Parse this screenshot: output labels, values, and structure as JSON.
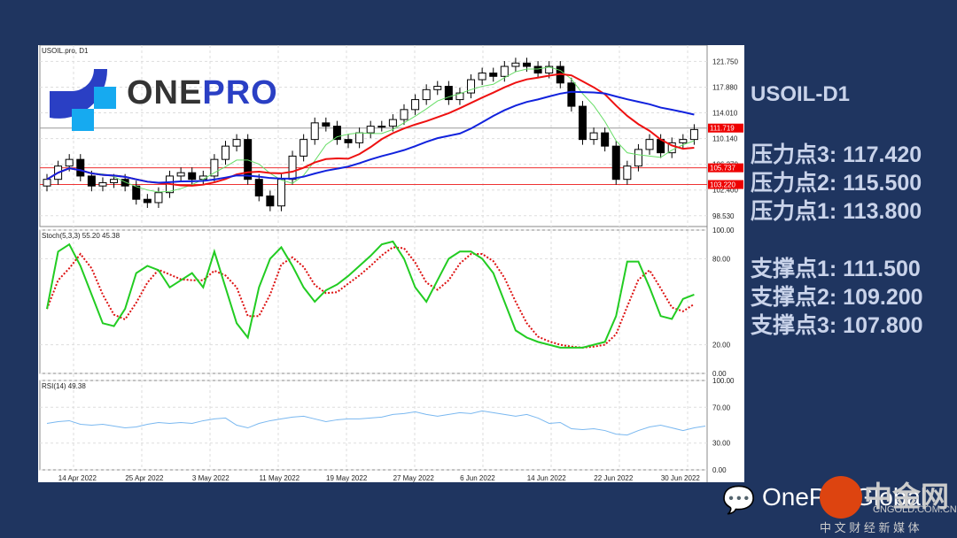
{
  "symbol_label": "USOIL.pro, D1",
  "logo": {
    "one": "ONE",
    "pro": "PRO"
  },
  "side_title": "USOIL-D1",
  "resistance": [
    "压力点3: 117.420",
    "压力点2: 115.500",
    "压力点1: 113.800"
  ],
  "support": [
    "支撑点1: 111.500",
    "支撑点2: 109.200",
    "支撑点3: 107.800"
  ],
  "footer": {
    "wechat": "OnePro Global",
    "brand_cn": "中金网",
    "brand_url": "CNGOLD.COM.CN",
    "brand_sub": "中 文 财 经 新 媒 体"
  },
  "colors": {
    "bg": "#1f3560",
    "ma_fast": "#66dd66",
    "ma_mid": "#ee1111",
    "ma_slow": "#1122dd",
    "stoch_k": "#22cc22",
    "stoch_d": "#dd1111",
    "rsi": "#7ab8f0"
  },
  "chart_data": {
    "type": "candlestick",
    "price_ticks": [
      "121.750",
      "117.880",
      "114.010",
      "110.140",
      "106.270",
      "102.400",
      "98.530"
    ],
    "price_range": [
      96.9,
      124.2
    ],
    "price_lines": [
      {
        "label": "111.719",
        "value": 111.719
      },
      {
        "label": "105.737",
        "value": 105.737
      },
      {
        "label": "103.220",
        "value": 103.22
      }
    ],
    "x_labels": [
      "14 Apr 2022",
      "25 Apr 2022",
      "3 May 2022",
      "11 May 2022",
      "19 May 2022",
      "27 May 2022",
      "6 Jun 2022",
      "14 Jun 2022",
      "22 Jun 2022",
      "30 Jun 2022"
    ],
    "x_label_index": [
      3,
      9,
      15,
      21,
      27,
      33,
      39,
      45,
      51,
      57
    ],
    "closes": [
      104,
      106,
      107,
      104.5,
      103,
      103.5,
      104,
      103,
      101,
      100.5,
      102,
      104.5,
      105,
      104,
      104.5,
      107,
      109,
      110,
      104,
      101.5,
      100,
      104,
      107.5,
      110,
      112.5,
      112,
      110,
      109.5,
      111,
      112,
      112,
      113,
      114.5,
      116,
      117.5,
      118,
      116,
      117,
      119,
      120,
      119.5,
      121,
      121.5,
      121,
      120,
      121,
      118.5,
      115,
      110,
      111,
      109,
      104,
      106,
      108.5,
      110,
      108,
      109.5,
      110,
      111.5
    ],
    "stoch": {
      "title": "Stoch(5,3,3) 55.20 45.38",
      "ticks": [
        "100.00",
        "80.00",
        "20.00",
        "0.00"
      ],
      "k": [
        45,
        85,
        90,
        75,
        55,
        35,
        33,
        45,
        70,
        75,
        72,
        60,
        65,
        70,
        60,
        85,
        60,
        35,
        25,
        60,
        80,
        88,
        75,
        60,
        50,
        58,
        62,
        68,
        75,
        82,
        90,
        92,
        80,
        60,
        50,
        65,
        80,
        85,
        85,
        80,
        70,
        50,
        30,
        25,
        22,
        20,
        18,
        18,
        18,
        20,
        22,
        40,
        78,
        78,
        60,
        40,
        38,
        52,
        55
      ]
    },
    "rsi": {
      "title": "RSI(14) 49.38",
      "ticks": [
        "100.00",
        "70.00",
        "30.00",
        "0.00"
      ],
      "values": [
        52,
        54,
        55,
        51,
        50,
        51,
        49,
        47,
        48,
        51,
        53,
        52,
        53,
        52,
        55,
        57,
        58,
        50,
        47,
        52,
        55,
        57,
        59,
        60,
        57,
        54,
        56,
        57,
        57,
        58,
        59,
        62,
        63,
        65,
        62,
        60,
        62,
        64,
        63,
        66,
        64,
        62,
        60,
        62,
        58,
        52,
        53,
        46,
        45,
        46,
        44,
        40,
        39,
        44,
        48,
        50,
        47,
        44,
        47,
        49
      ]
    }
  }
}
